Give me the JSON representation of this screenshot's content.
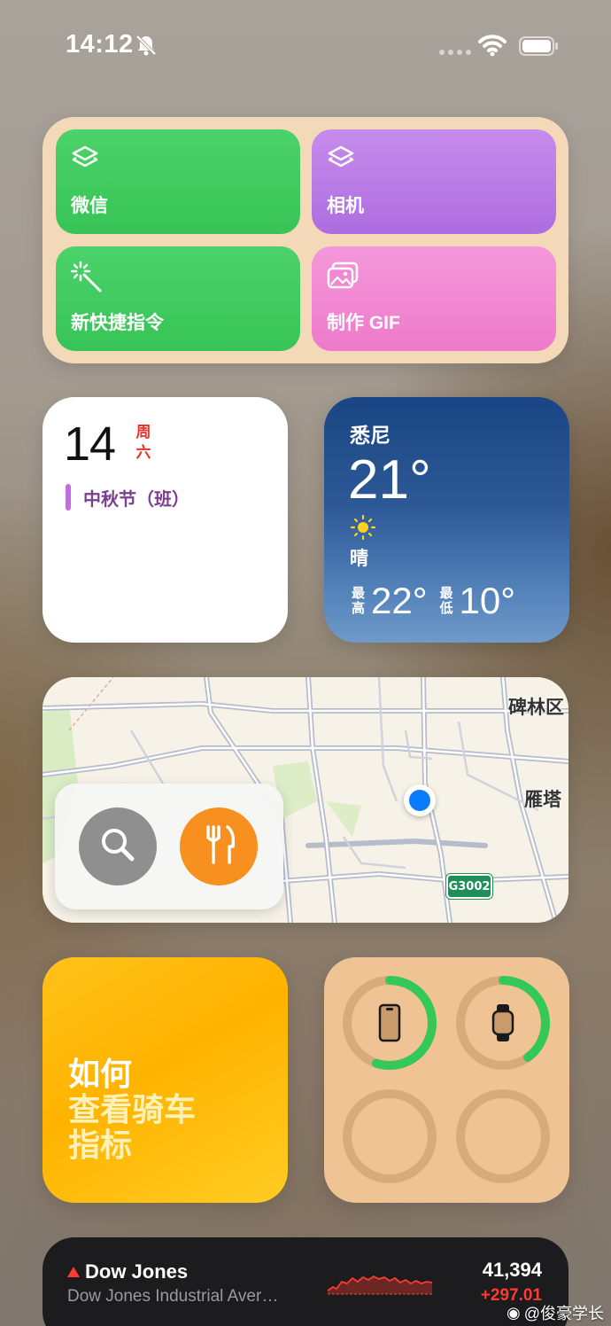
{
  "status_bar": {
    "time": "14:12"
  },
  "shortcuts": {
    "tiles": [
      {
        "label": "微信",
        "icon": "layers-icon",
        "color": "#3fcb5e"
      },
      {
        "label": "相机",
        "icon": "layers-icon",
        "color": "#b978e6"
      },
      {
        "label": "新快捷指令",
        "icon": "magic-wand-icon",
        "color": "#3fcb5e"
      },
      {
        "label": "制作 GIF",
        "icon": "photos-icon",
        "color": "#f287d2"
      }
    ]
  },
  "calendar": {
    "day": "14",
    "weekday": "周六",
    "weekday_line1": "周",
    "weekday_line2": "六",
    "event": "中秋节（班）"
  },
  "weather": {
    "city": "悉尼",
    "temp": "21°",
    "condition": "晴",
    "high_label_1": "最",
    "high_label_2": "高",
    "high": "22°",
    "low_label_1": "最",
    "low_label_2": "低",
    "low": "10°"
  },
  "map": {
    "labels": [
      "碑林区",
      "雁塔"
    ],
    "road_shield": "G3002"
  },
  "tips": {
    "line1": "如何",
    "line2": "查看骑车",
    "line3": "指标"
  },
  "batteries": {
    "devices": [
      {
        "name": "iphone-icon",
        "level": 0.55
      },
      {
        "name": "watch-icon",
        "level": 0.4
      },
      {
        "name": "empty-slot",
        "level": 0
      },
      {
        "name": "empty-slot",
        "level": 0
      }
    ],
    "ring_color": "#34c759"
  },
  "stocks": {
    "symbol": "Dow Jones",
    "full_name": "Dow Jones Industrial Aver…",
    "price": "41,394",
    "change": "+297.01"
  },
  "watermark": "@俊豪学长"
}
